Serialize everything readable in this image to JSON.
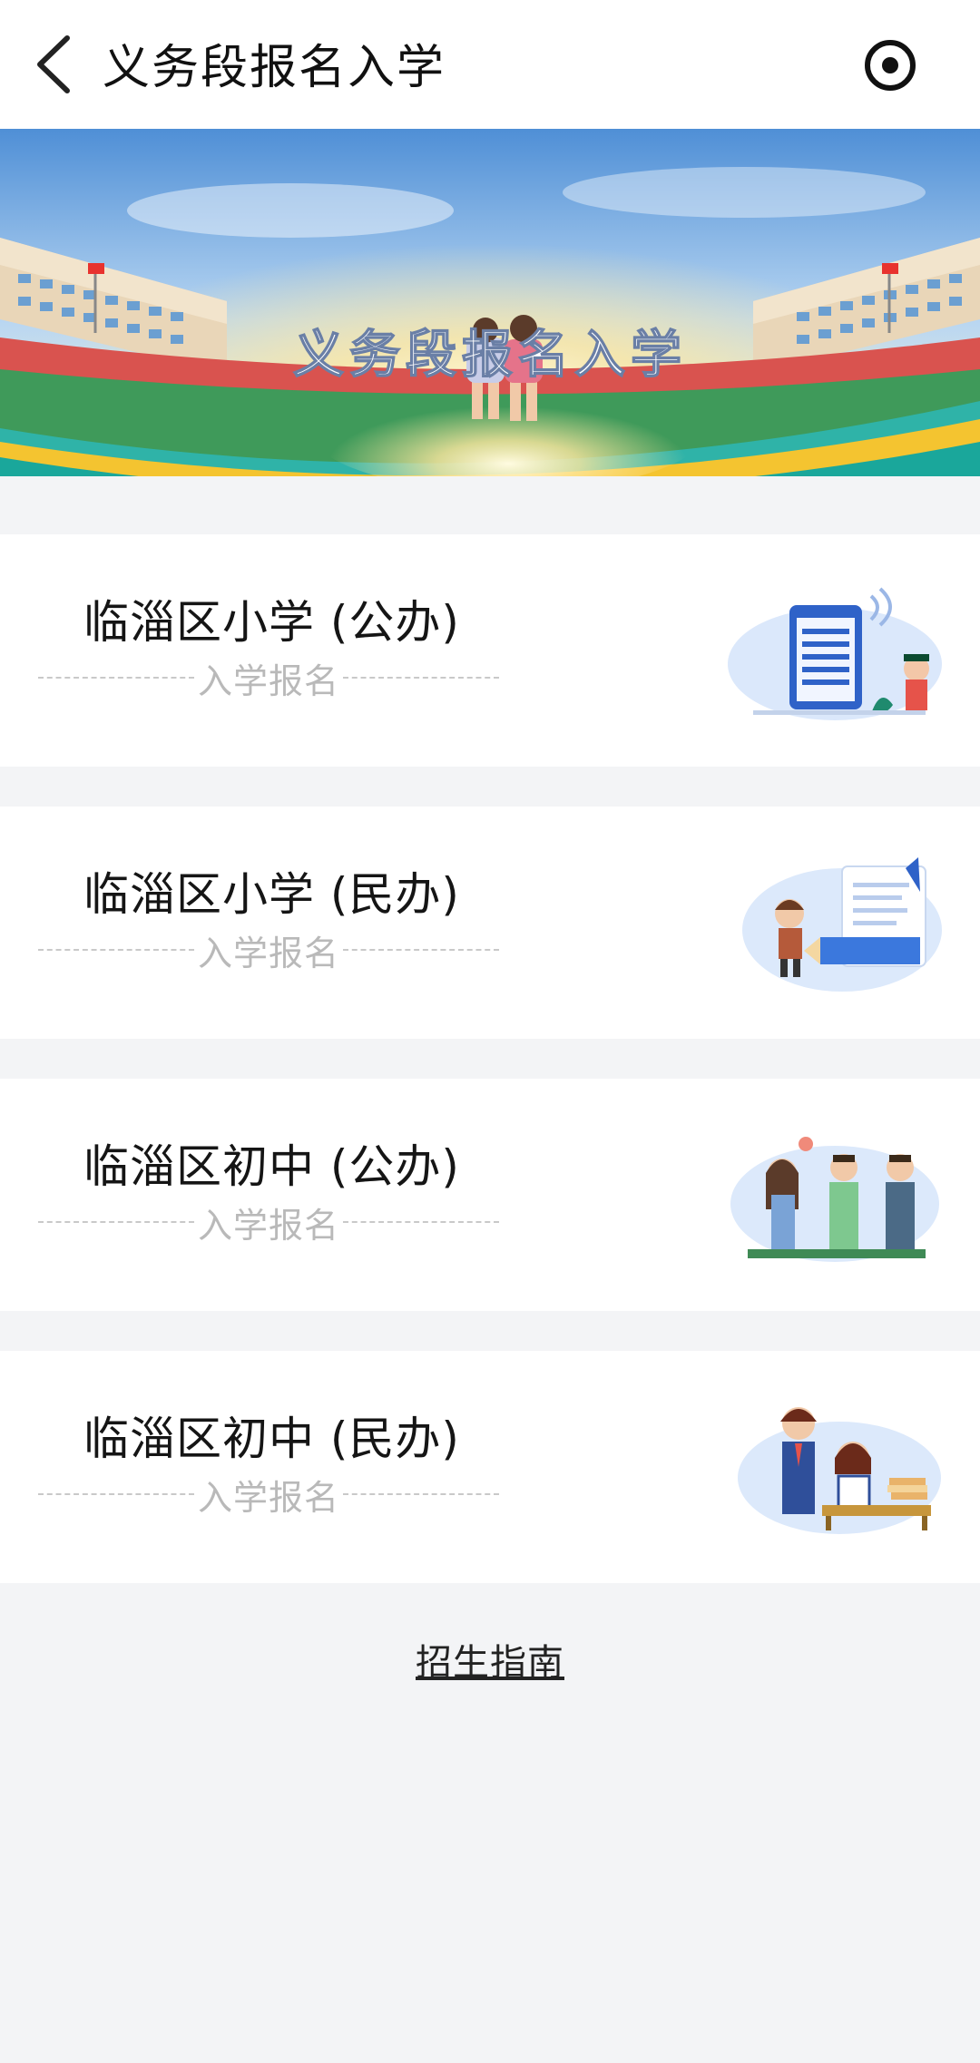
{
  "header": {
    "title": "义务段报名入学",
    "back_icon": "chevron-left-icon",
    "menu_icon": "target-icon"
  },
  "banner": {
    "title": "义务段报名入学"
  },
  "entries": [
    {
      "title": "临淄区小学 (公办)",
      "subtitle": "入学报名",
      "art": "school-kiosk-illustration"
    },
    {
      "title": "临淄区小学 (民办)",
      "subtitle": "入学报名",
      "art": "kid-document-illustration"
    },
    {
      "title": "临淄区初中 (公办)",
      "subtitle": "入学报名",
      "art": "students-group-illustration"
    },
    {
      "title": "临淄区初中 (民办)",
      "subtitle": "入学报名",
      "art": "students-desk-illustration"
    }
  ],
  "footer": {
    "guide_link": "招生指南"
  },
  "colors": {
    "background": "#f3f4f6",
    "card": "#ffffff",
    "subtitle": "#b9b9b9"
  }
}
